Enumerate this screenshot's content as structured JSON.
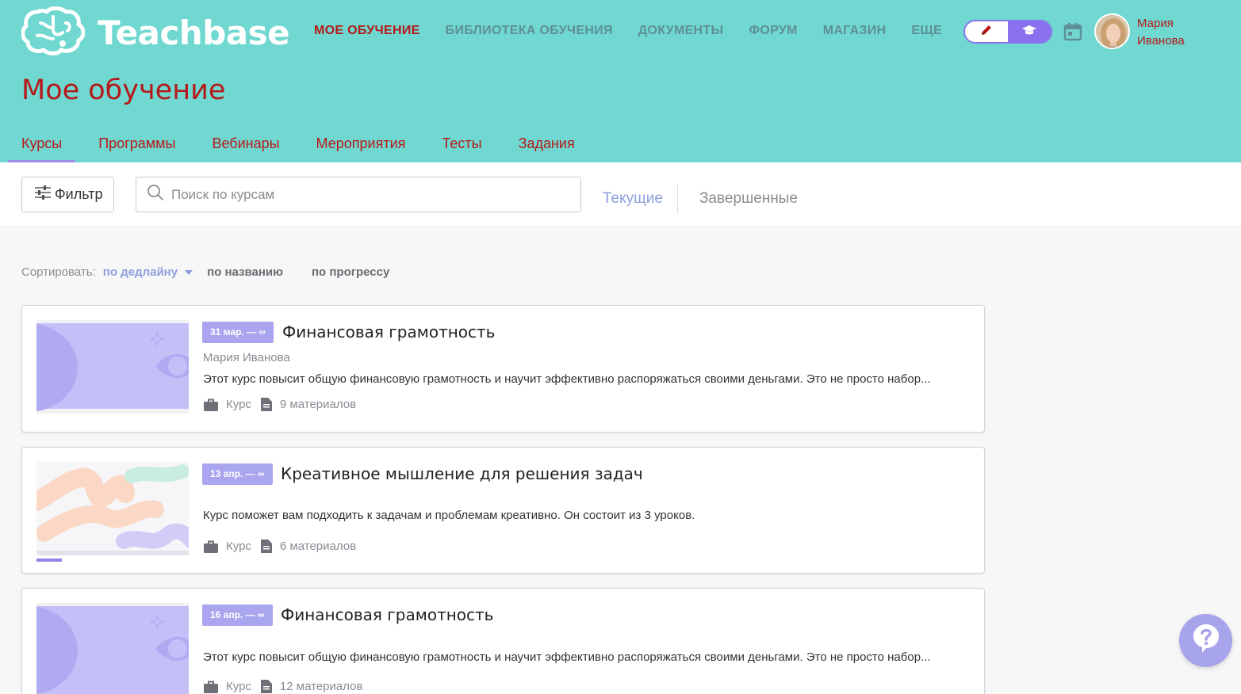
{
  "app": {
    "logo_text": "Teachbase"
  },
  "topnav": {
    "items": [
      {
        "label": "МОЕ ОБУЧЕНИЕ",
        "active": true
      },
      {
        "label": "БИБЛИОТЕКА ОБУЧЕНИЯ",
        "active": false
      },
      {
        "label": "ДОКУМЕНТЫ",
        "active": false
      },
      {
        "label": "ФОРУМ",
        "active": false
      },
      {
        "label": "МАГАЗИН",
        "active": false
      },
      {
        "label": "ЕЩЕ",
        "active": false
      }
    ],
    "mode_icons": [
      "pencil-icon",
      "graduation-cap-icon"
    ],
    "calendar_icon": "calendar-icon"
  },
  "user": {
    "first_name": "Мария",
    "last_name": "Иванова"
  },
  "page": {
    "title": "Мое обучение"
  },
  "subtabs": [
    {
      "label": "Курсы",
      "active": true
    },
    {
      "label": "Программы",
      "active": false
    },
    {
      "label": "Вебинары",
      "active": false
    },
    {
      "label": "Мероприятия",
      "active": false
    },
    {
      "label": "Тесты",
      "active": false
    },
    {
      "label": "Задания",
      "active": false
    }
  ],
  "toolbar": {
    "filter_label": "Фильтр",
    "search_placeholder": "Поиск по курсам",
    "state_current": "Текущие",
    "state_finished": "Завершенные"
  },
  "sort": {
    "label": "Сортировать:",
    "options": [
      "по дедлайну",
      "по названию",
      "по прогрессу"
    ],
    "active_index": 0
  },
  "courses": [
    {
      "badge": "31 мар. — ∞",
      "title": "Финансовая грамотность",
      "author": "Мария Иванова",
      "description": "Этот курс повысит общую финансовую грамотность и научит эффективно распоряжаться своими деньгами. Это не просто набор...",
      "type": "Курс",
      "materials": "9 материалов",
      "thumb": "purple-abstract"
    },
    {
      "badge": "13 апр. — ∞",
      "title": "Креативное мышление для решения задач",
      "author": "",
      "description": "Курс поможет вам подходить к задачам и проблемам креативно. Он состоит из 3 уроков.",
      "type": "Курс",
      "materials": "6 материалов",
      "thumb": "brush-strokes"
    },
    {
      "badge": "16 апр. — ∞",
      "title": "Финансовая грамотность",
      "author": "",
      "description": "Этот курс повысит общую финансовую грамотность и научит эффективно распоряжаться своими деньгами. Это не просто набор...",
      "type": "Курс",
      "materials": "12 материалов",
      "thumb": "purple-abstract"
    }
  ],
  "colors": {
    "header_bg": "#70d8d0",
    "accent_red": "#b5191a",
    "accent_purple": "#8a72ef",
    "badge_bg": "#a9a5ee",
    "link_blue": "#8d9fdc"
  }
}
